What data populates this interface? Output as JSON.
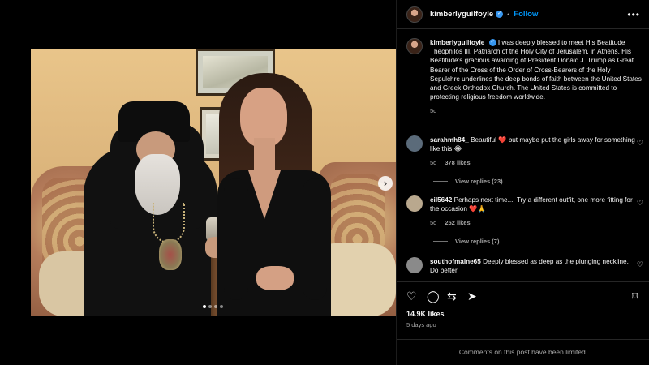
{
  "post": {
    "username": "kimberlyguilfoyle",
    "separator": "•",
    "follow_label": "Follow",
    "more_label": "•••",
    "caption": "I was deeply blessed to meet His Beatitude Theophilos III, Patriarch of the Holy City of Jerusalem, in Athens. His Beatitude’s gracious awarding of President Donald J. Trump as Great Bearer of the Cross of the Order of Cross-Bearers of the Holy Sepulchre underlines the deep bonds of faith between the United States and Greek Orthodox Church. The United States is committed to protecting religious freedom worldwide.",
    "caption_time": "5d",
    "likes": "14.9K likes",
    "age": "5 days ago",
    "limited_notice": "Comments on this post have been limited."
  },
  "carousel": {
    "next_icon": "chevron-right-icon",
    "next_glyph": "›",
    "dots": 4,
    "active_dot": 1
  },
  "comments": [
    {
      "username": "sarahmh84_",
      "text_before": "Beautiful ",
      "emoji": "❤️",
      "text_after": " but maybe put the girls away for something like this 😂",
      "time": "5d",
      "likes": "378 likes",
      "replies": "View replies (23)",
      "avatar_color": "#5b6b7a"
    },
    {
      "username": "eil5642",
      "text_before": "Perhaps next time.... Try a different outfit, one more fitting for the occasion ",
      "emoji": "❤️🙏",
      "text_after": "",
      "time": "5d",
      "likes": "252 likes",
      "replies": "View replies (7)",
      "avatar_color": "#b9a88e"
    },
    {
      "username": "southofmaine65",
      "text_before": "Deeply blessed as deep as the plunging neckline. Do better.",
      "emoji": "",
      "text_after": "",
      "avatar_color": "#8a8a8a"
    }
  ],
  "icons": {
    "heart": "♡",
    "comment": "◯",
    "share": "⇆",
    "send": "➤",
    "bookmark": "⌑",
    "verified": "✓"
  },
  "colors": {
    "accent": "#0095f6",
    "verified": "#3797f0",
    "background": "#000000",
    "muted": "#a8a8a8"
  }
}
